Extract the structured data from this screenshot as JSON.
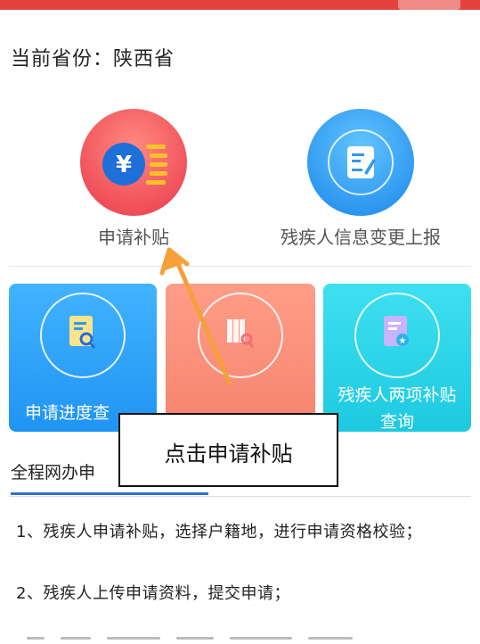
{
  "header": {
    "province_text": "当前省份：陕西省"
  },
  "main_services": [
    {
      "label": "申请补贴",
      "icon": "yen-coin-icon"
    },
    {
      "label": "残疾人信息变更上报",
      "icon": "edit-document-icon"
    }
  ],
  "cards": [
    {
      "label": "申请进度查",
      "icon": "document-search-icon"
    },
    {
      "label": "",
      "icon": "binders-search-icon"
    },
    {
      "label_line1": "残疾人两项补贴",
      "label_line2": "查询",
      "icon": "document-badge-icon"
    }
  ],
  "callout": {
    "text": "点击申请补贴"
  },
  "section": {
    "title": "全程网办申"
  },
  "steps": [
    "1、残疾人申请补贴，选择户籍地，进行申请资格校验；",
    "2、残疾人上传申请资料，提交申请；"
  ],
  "colors": {
    "accent_red": "#e4423f",
    "blue": "#2f99f0",
    "arrow_orange": "#f5a03a",
    "underline_blue": "#2f6fd8"
  }
}
